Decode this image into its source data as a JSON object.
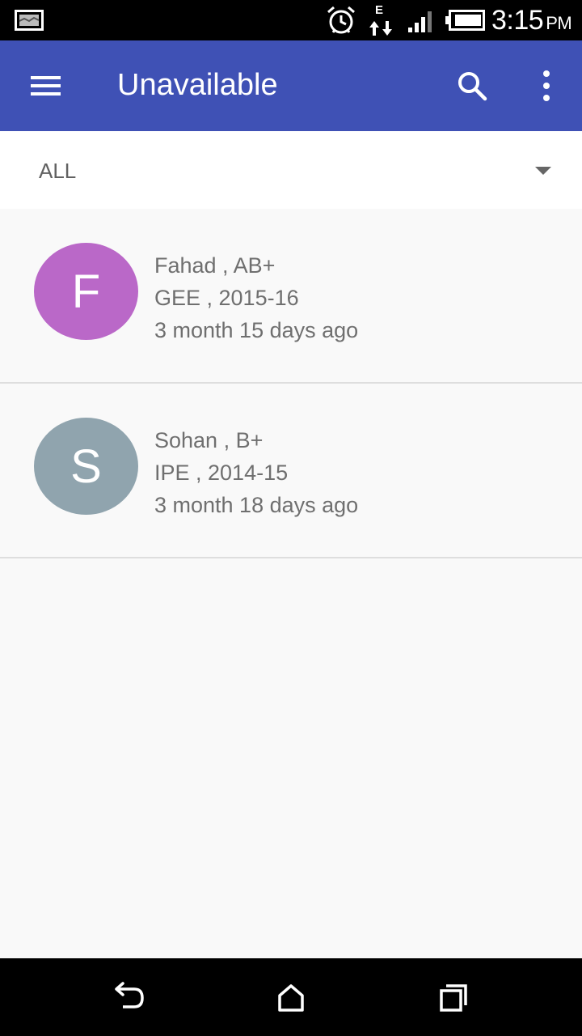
{
  "status_bar": {
    "time": "3:15",
    "ampm": "PM",
    "data_indicator": "E",
    "icons": [
      "gallery-icon",
      "alarm-icon",
      "data-transfer-icon",
      "signal-icon",
      "battery-icon"
    ]
  },
  "app_bar": {
    "title": "Unavailable",
    "color": "#3f51b5",
    "icons": [
      "menu-icon",
      "search-icon",
      "more-vert-icon"
    ]
  },
  "filter": {
    "selected": "ALL"
  },
  "donors": [
    {
      "initial": "F",
      "avatar_color": "#ba68c8",
      "line1": "Fahad , AB+",
      "line2": "GEE , 2015-16",
      "line3": "3 month 15 days ago"
    },
    {
      "initial": "S",
      "avatar_color": "#90a4ae",
      "line1": "Sohan , B+",
      "line2": "IPE , 2014-15",
      "line3": "3 month 18 days ago"
    }
  ],
  "nav_bar": {
    "icons": [
      "back-icon",
      "home-icon",
      "recent-apps-icon"
    ]
  }
}
